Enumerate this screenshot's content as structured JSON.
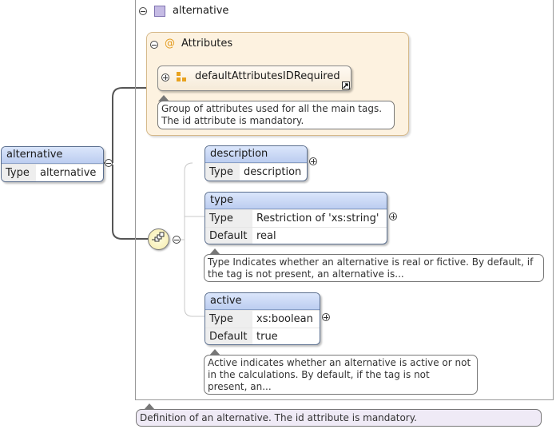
{
  "root_element": {
    "name": "alternative",
    "type_key": "Type",
    "type_value": "alternative"
  },
  "complex_type": {
    "name": "alternative",
    "documentation": "Definition of an alternative. The id attribute is mandatory."
  },
  "attributes": {
    "label": "Attributes",
    "group_ref": {
      "name": "defaultAttributesIDRequired",
      "documentation_line1": "Group of attributes used for all the main tags.",
      "documentation_line2": "The id attribute is mandatory."
    }
  },
  "children": {
    "description": {
      "name": "description",
      "type_key": "Type",
      "type_value": "description"
    },
    "type": {
      "name": "type",
      "type_key": "Type",
      "type_value": "Restriction of 'xs:string'",
      "default_key": "Default",
      "default_value": "real",
      "documentation_line1": "Type Indicates whether an alternative is real or fictive. By default, if",
      "documentation_line2": "the tag is not present, an alternative is..."
    },
    "active": {
      "name": "active",
      "type_key": "Type",
      "type_value": "xs:boolean",
      "default_key": "Default",
      "default_value": "true",
      "documentation_line1": "Active indicates whether an alternative is active or not",
      "documentation_line2": "in the calculations. By default, if the tag is not",
      "documentation_line3": "present, an..."
    }
  },
  "icons": {
    "complex_type": "complex-type-square-icon",
    "attributes": "at-sign-icon",
    "attribute_group": "attribute-group-icon",
    "reference": "reference-arrow-icon",
    "sequence": "sequence-compositor-icon"
  },
  "colors": {
    "element_header": "#c8d6f4",
    "attributes_panel": "#fdf2e0",
    "doc_bubble_complex": "#efeaf6",
    "compositor": "#fff9c8"
  }
}
